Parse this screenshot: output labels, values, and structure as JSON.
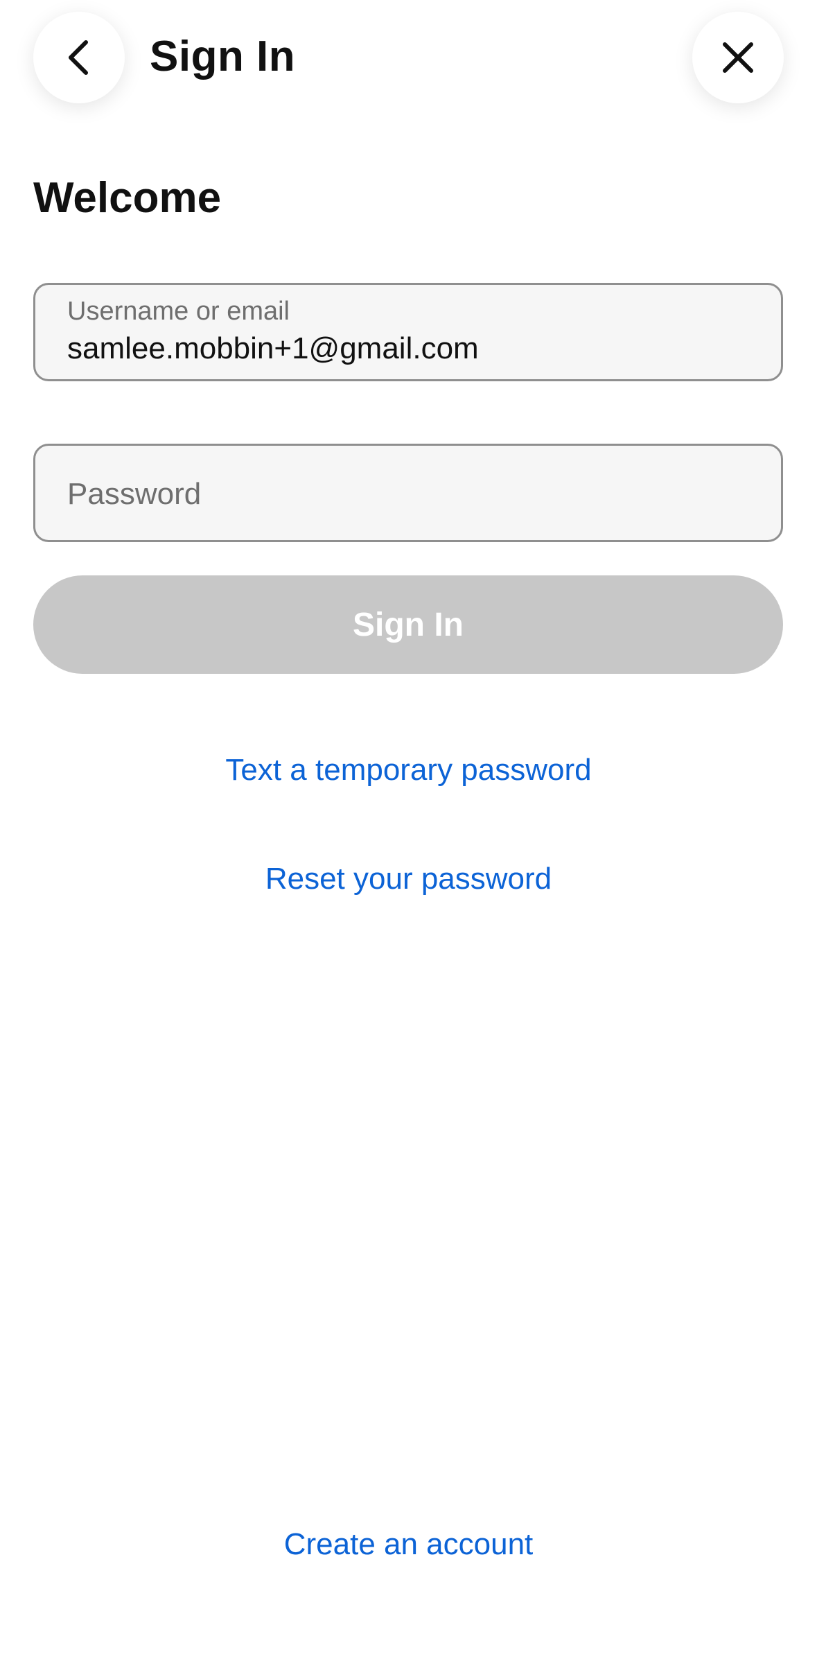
{
  "header": {
    "title": "Sign In",
    "back_icon": "chevron-left-icon",
    "close_icon": "close-icon"
  },
  "main": {
    "heading": "Welcome",
    "username_field": {
      "label": "Username or email",
      "value": "samlee.mobbin+1@gmail.com"
    },
    "password_field": {
      "placeholder": "Password",
      "value": ""
    },
    "signin_button": {
      "label": "Sign In",
      "state": "disabled"
    },
    "links": {
      "temporary_password": "Text a temporary password",
      "reset_password": "Reset your password"
    }
  },
  "footer": {
    "create_account": "Create an account"
  },
  "colors": {
    "link": "#0c63d6",
    "disabled_button": "#c7c7c7",
    "field_background": "#f6f6f6",
    "field_border": "#8f8f8f",
    "text": "#111111"
  }
}
